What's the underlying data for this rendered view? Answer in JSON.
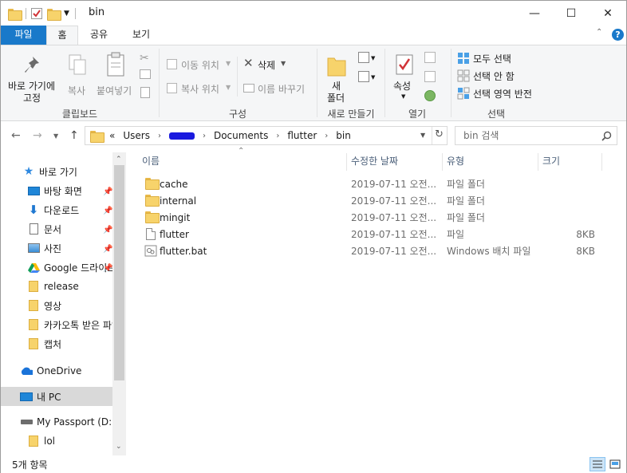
{
  "window": {
    "title": "bin",
    "controls": {
      "minimize": "—",
      "maximize": "☐",
      "close": "✕"
    }
  },
  "ribbon_tabs": [
    {
      "label": "파일"
    },
    {
      "label": "홈"
    },
    {
      "label": "공유"
    },
    {
      "label": "보기"
    }
  ],
  "ribbon": {
    "clipboard": {
      "pin_label_1": "바로 가기에",
      "pin_label_2": "고정",
      "copy": "복사",
      "paste": "붙여넣기",
      "group": "클립보드"
    },
    "organize": {
      "move_to": "이동 위치",
      "copy_to": "복사 위치",
      "delete": "삭제",
      "rename": "이름 바꾸기",
      "group": "구성"
    },
    "new": {
      "new_folder_1": "새",
      "new_folder_2": "폴더",
      "group": "새로 만들기"
    },
    "open": {
      "properties": "속성",
      "group": "열기"
    },
    "select": {
      "select_all": "모두 선택",
      "select_none": "선택 안 함",
      "invert": "선택 영역 반전",
      "group": "선택"
    }
  },
  "address": {
    "overflow": "«",
    "crumbs": [
      "Users",
      "",
      "Documents",
      "flutter",
      "bin"
    ],
    "search_placeholder": "bin 검색"
  },
  "nav": [
    {
      "label": "바로 가기",
      "icon": "star-icon",
      "pinned": false
    },
    {
      "label": "바탕 화면",
      "icon": "desktop-icon",
      "pinned": true
    },
    {
      "label": "다운로드",
      "icon": "download-icon",
      "pinned": true
    },
    {
      "label": "문서",
      "icon": "document-icon",
      "pinned": true
    },
    {
      "label": "사진",
      "icon": "pictures-icon",
      "pinned": true
    },
    {
      "label": "Google 드라이브",
      "icon": "google-drive-icon",
      "pinned": true
    },
    {
      "label": "release",
      "icon": "folder-icon",
      "pinned": false
    },
    {
      "label": "영상",
      "icon": "folder-icon",
      "pinned": false
    },
    {
      "label": "카카오톡 받은 파일",
      "icon": "folder-icon",
      "pinned": false
    },
    {
      "label": "캡처",
      "icon": "folder-icon",
      "pinned": false
    },
    {
      "label": "OneDrive",
      "icon": "onedrive-icon",
      "pinned": false
    },
    {
      "label": "내 PC",
      "icon": "pc-icon",
      "pinned": false
    },
    {
      "label": "My Passport (D:)",
      "icon": "drive-icon",
      "pinned": false
    },
    {
      "label": "lol",
      "icon": "folder-icon",
      "pinned": false
    }
  ],
  "columns": {
    "name": "이름",
    "modified": "수정한 날짜",
    "type": "유형",
    "size": "크기"
  },
  "files": [
    {
      "name": "cache",
      "modified": "2019-07-11 오전...",
      "type": "파일 폴더",
      "size": "",
      "icon": "folder-icon"
    },
    {
      "name": "internal",
      "modified": "2019-07-11 오전...",
      "type": "파일 폴더",
      "size": "",
      "icon": "folder-icon"
    },
    {
      "name": "mingit",
      "modified": "2019-07-11 오전...",
      "type": "파일 폴더",
      "size": "",
      "icon": "folder-icon"
    },
    {
      "name": "flutter",
      "modified": "2019-07-11 오전...",
      "type": "파일",
      "size": "8KB",
      "icon": "file-icon"
    },
    {
      "name": "flutter.bat",
      "modified": "2019-07-11 오전...",
      "type": "Windows 배치 파일",
      "size": "8KB",
      "icon": "batch-file-icon"
    }
  ],
  "status": {
    "item_count": "5개 항목"
  }
}
